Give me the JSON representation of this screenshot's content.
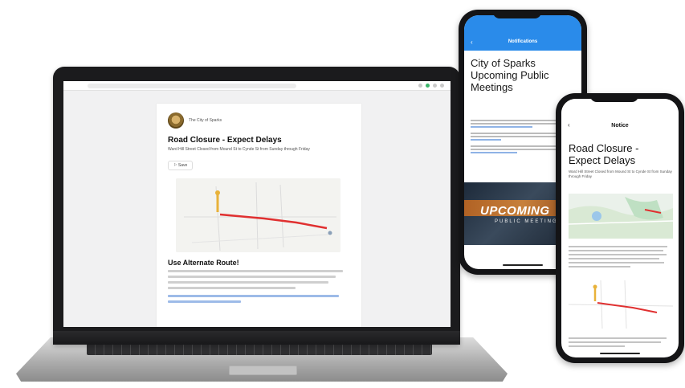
{
  "laptop": {
    "article": {
      "org_name": "The City of Sparks",
      "title": "Road Closure - Expect Delays",
      "subtitle": "Ward Hill Street Closed from Mound St to Cynde St from Sunday through Friday",
      "date": "",
      "share_label": "Save",
      "section_heading": "Use Alternate Route!"
    }
  },
  "phone_meetings": {
    "app_bar_title": "Notifications",
    "back_icon": "chevron-left-icon",
    "title": "City of Sparks Upcoming Public Meetings",
    "subtitle": "",
    "banner_big": "UPCOMING",
    "banner_small": "PUBLIC MEETINGS"
  },
  "phone_notice": {
    "app_bar_title": "Notice",
    "back_icon": "chevron-left-icon",
    "title": "Road Closure - Expect Delays",
    "subtitle": "Ward Hill Street Closed from Mound St to Cynde St from Sunday through Friday"
  },
  "colors": {
    "app_blue": "#2a8bea",
    "route_red": "#e03030",
    "marker_yellow": "#e8b23a"
  }
}
